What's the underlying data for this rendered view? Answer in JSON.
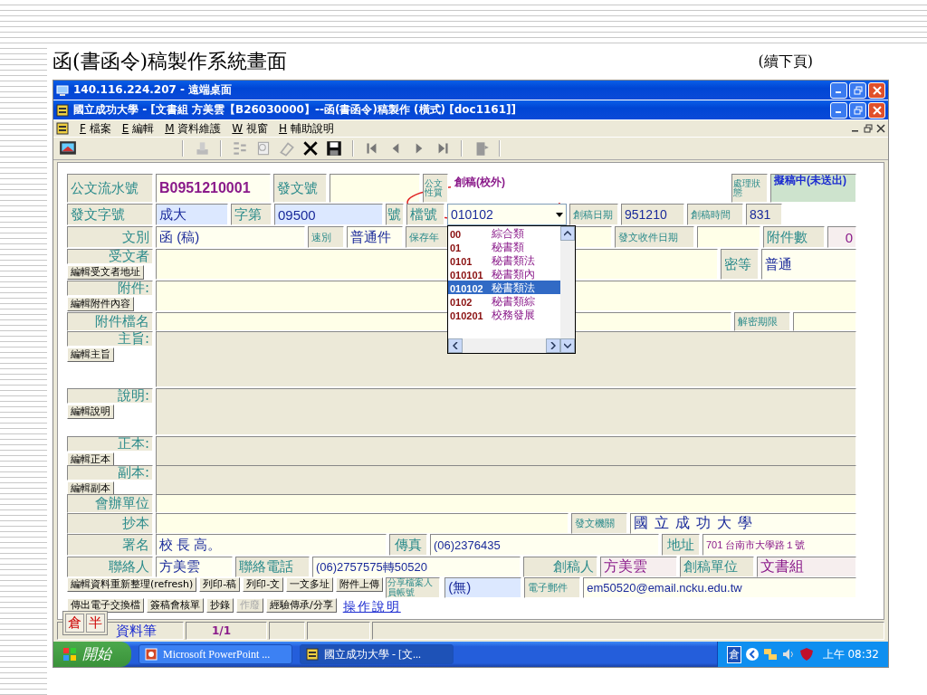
{
  "slide": {
    "title": "函(書函令)稿製作系統畫面",
    "note": "(續下頁)"
  },
  "remote_window": {
    "title": "140.116.224.207 - 遠端桌面"
  },
  "app_window": {
    "title": "國立成功大學 - [文書組 方美雲【B26030000】--函(書函令)稿製作 (橫式) [doc1161]]"
  },
  "menu": [
    {
      "key": "F",
      "label": "檔案"
    },
    {
      "key": "E",
      "label": "編輯"
    },
    {
      "key": "M",
      "label": "資料維護"
    },
    {
      "key": "W",
      "label": "視窗"
    },
    {
      "key": "H",
      "label": "輔助說明"
    }
  ],
  "form": {
    "lines": [
      {
        "parts": [
          {
            "kind": "label",
            "text": "公文流水號"
          },
          {
            "kind": "value",
            "text": "B0951210001"
          },
          {
            "kind": "label",
            "text": "發文號"
          },
          {
            "kind": "field"
          },
          {
            "kind": "label",
            "text": "公文性質"
          },
          {
            "kind": "value",
            "text": "創稿(校外)"
          },
          {
            "kind": "label",
            "text": "處理狀態"
          },
          {
            "kind": "value",
            "text": "擬稿中(未送出)"
          }
        ]
      },
      {
        "parts": [
          {
            "kind": "label",
            "text": "發文字號"
          },
          {
            "kind": "value",
            "text": "成大"
          },
          {
            "kind": "label",
            "text": "字第"
          },
          {
            "kind": "value",
            "text": "09500"
          },
          {
            "kind": "label",
            "text": "號"
          },
          {
            "kind": "label",
            "text": "檔號"
          },
          {
            "kind": "combo",
            "text": "010102",
            "expanded": true,
            "options": [
              {
                "code": "00",
                "name": "綜合類",
                "selected": false
              },
              {
                "code": "01",
                "name": "秘書類",
                "selected": false
              },
              {
                "code": "0101",
                "name": "秘書類法",
                "selected": false
              },
              {
                "code": "010101",
                "name": "秘書類內",
                "selected": false
              },
              {
                "code": "010102",
                "name": "秘書類法",
                "selected": true
              },
              {
                "code": "0102",
                "name": "秘書類綜",
                "selected": false
              },
              {
                "code": "010201",
                "name": "校務發展",
                "selected": false
              }
            ]
          },
          {
            "kind": "label",
            "text": "創稿日期"
          },
          {
            "kind": "value",
            "text": "951210"
          },
          {
            "kind": "label",
            "text": "創稿時間"
          },
          {
            "kind": "value",
            "text": "831"
          }
        ]
      },
      {
        "parts": [
          {
            "kind": "label",
            "text": "文別"
          },
          {
            "kind": "value",
            "text": "函 (稿)"
          },
          {
            "kind": "label",
            "text": "速別"
          },
          {
            "kind": "value",
            "text": "普通件"
          },
          {
            "kind": "label",
            "text": "保存年"
          },
          {
            "kind": "field"
          },
          {
            "kind": "label",
            "text": "發文收件日期"
          },
          {
            "kind": "field"
          },
          {
            "kind": "label",
            "text": "附件數"
          },
          {
            "kind": "value",
            "text": "0"
          }
        ]
      },
      {
        "parts": [
          {
            "kind": "label_button",
            "label": "受文者",
            "button": "編輯受文者地址"
          },
          {
            "kind": "field"
          },
          {
            "kind": "label",
            "text": "密等"
          },
          {
            "kind": "value",
            "text": "普通"
          }
        ]
      },
      {
        "parts": [
          {
            "kind": "label_button",
            "label": "附件:",
            "button": "編輯附件內容"
          },
          {
            "kind": "field"
          }
        ]
      },
      {
        "parts": [
          {
            "kind": "label",
            "text": "附件檔名"
          },
          {
            "kind": "field"
          },
          {
            "kind": "label",
            "text": "解密期限"
          },
          {
            "kind": "field"
          }
        ]
      },
      {
        "parts": [
          {
            "kind": "label_button",
            "label": "主旨:",
            "button": "編輯主旨"
          },
          {
            "kind": "field"
          }
        ]
      },
      {
        "parts": [
          {
            "kind": "label_button",
            "label": "說明:",
            "button": "編輯說明"
          },
          {
            "kind": "field"
          }
        ]
      },
      {
        "parts": [
          {
            "kind": "label_button",
            "label": "正本:",
            "button": "編輯正本"
          },
          {
            "kind": "field"
          }
        ]
      },
      {
        "parts": [
          {
            "kind": "label_button",
            "label": "副本:",
            "button": "編輯副本"
          },
          {
            "kind": "field"
          }
        ]
      },
      {
        "parts": [
          {
            "kind": "label",
            "text": "會辦單位"
          },
          {
            "kind": "field"
          }
        ]
      },
      {
        "parts": [
          {
            "kind": "label",
            "text": "抄本"
          },
          {
            "kind": "field"
          },
          {
            "kind": "label",
            "text": "發文機關"
          },
          {
            "kind": "value",
            "text": "國立成功大學"
          }
        ]
      },
      {
        "parts": [
          {
            "kind": "label",
            "text": "署名"
          },
          {
            "kind": "value",
            "text": "校 長 高。"
          },
          {
            "kind": "label",
            "text": "傳真"
          },
          {
            "kind": "value",
            "text": "(06)2376435"
          },
          {
            "kind": "label",
            "text": "地址"
          },
          {
            "kind": "value",
            "text": "701 台南市大學路１號"
          }
        ]
      },
      {
        "parts": [
          {
            "kind": "label",
            "text": "聯絡人"
          },
          {
            "kind": "value",
            "text": "方美雲"
          },
          {
            "kind": "label",
            "text": "聯絡電話"
          },
          {
            "kind": "value",
            "text": "(06)2757575轉50520"
          },
          {
            "kind": "label",
            "text": "創稿人"
          },
          {
            "kind": "value",
            "text": "方美雲"
          },
          {
            "kind": "label",
            "text": "創稿單位"
          },
          {
            "kind": "value",
            "text": "文書組"
          }
        ]
      },
      {
        "parts": [
          {
            "kind": "button",
            "text": "編輯資料重新整理(refresh)",
            "disabled": false
          },
          {
            "kind": "button",
            "text": "列印-稿",
            "disabled": false
          },
          {
            "kind": "button",
            "text": "列印-文",
            "disabled": false
          },
          {
            "kind": "button",
            "text": "一文多址",
            "disabled": false
          },
          {
            "kind": "button",
            "text": "附件上傳",
            "disabled": false
          },
          {
            "kind": "label",
            "text": "分享檔案人員帳號"
          },
          {
            "kind": "value",
            "text": "(無)"
          },
          {
            "kind": "label",
            "text": "電子郵件"
          },
          {
            "kind": "value",
            "text": "em50520@email.ncku.edu.tw"
          }
        ]
      },
      {
        "parts": [
          {
            "kind": "button",
            "text": "傳出電子交換檔",
            "disabled": false
          },
          {
            "kind": "button",
            "text": "簽稿會核單",
            "disabled": false
          },
          {
            "kind": "button",
            "text": "抄錄",
            "disabled": false
          },
          {
            "kind": "button",
            "text": "作廢",
            "disabled": true
          },
          {
            "kind": "button",
            "text": "經驗傳承/分享",
            "disabled": false
          },
          {
            "kind": "link",
            "text": "操作說明"
          }
        ]
      }
    ]
  },
  "status_bar": {
    "label": "資料筆",
    "position": "1/1"
  },
  "ime": [
    "倉",
    "半"
  ],
  "taskbar": {
    "start": "開始",
    "tasks": [
      {
        "label": "Microsoft PowerPoint ...",
        "selected": false
      },
      {
        "label": "國立成功大學 - [文...",
        "selected": true
      }
    ],
    "tray_ime": "倉",
    "clock": "上午 08:32"
  }
}
